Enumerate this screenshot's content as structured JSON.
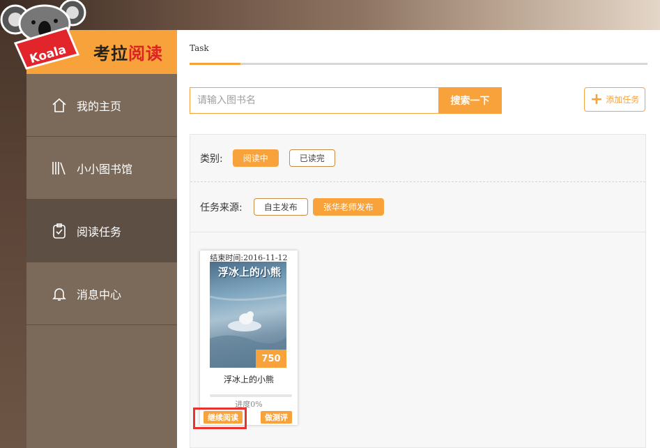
{
  "app": {
    "logo_text_a": "考拉",
    "logo_text_b": "阅读",
    "logo_badge": "Koala"
  },
  "sidebar": {
    "items": [
      {
        "label": "我的主页",
        "icon": "home-icon"
      },
      {
        "label": "小小图书馆",
        "icon": "library-icon"
      },
      {
        "label": "阅读任务",
        "icon": "clipboard-check-icon",
        "active": true
      },
      {
        "label": "消息中心",
        "icon": "bell-icon"
      }
    ]
  },
  "main": {
    "tab": "Task",
    "search": {
      "placeholder": "请输入图书名",
      "button": "搜索一下"
    },
    "add_task": "添加任务",
    "filters": {
      "category_label": "类别:",
      "category_options": [
        "阅读中",
        "已读完"
      ],
      "category_selected": "阅读中",
      "source_label": "任务来源:",
      "source_options": [
        "自主发布",
        "张华老师发布"
      ],
      "source_selected": "张华老师发布"
    },
    "books": [
      {
        "end_time": "结束时间:2016-11-12",
        "cover_title": "浮冰上的小熊",
        "score": "750",
        "name": "浮冰上的小熊",
        "progress_text": "进度0%",
        "progress": 0,
        "continue_label": "继续阅读",
        "review_label": "做测评"
      }
    ]
  },
  "colors": {
    "accent": "#f7a23b",
    "sidebar": "#7b6a5a",
    "sidebar_active": "#5e4f44",
    "highlight": "#e8322f"
  }
}
